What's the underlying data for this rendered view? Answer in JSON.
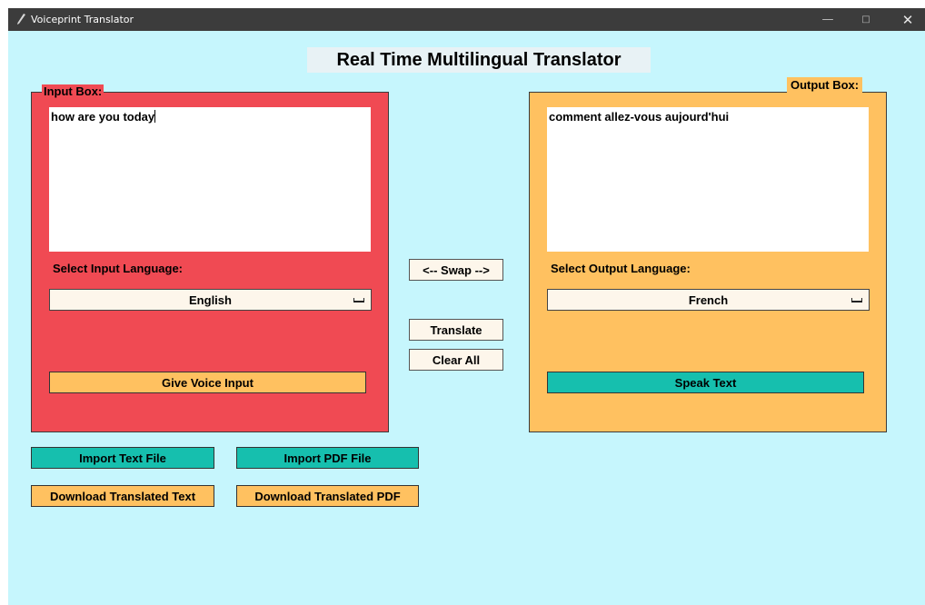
{
  "window": {
    "title": "Voiceprint Translator",
    "controls": {
      "minimize": "—",
      "maximize": "□",
      "close": "✕"
    }
  },
  "app": {
    "heading": "Real Time Multilingual Translator"
  },
  "input_panel": {
    "legend": "Input Box:",
    "text": "how are you today",
    "language_label": "Select Input Language:",
    "language_selected": "English",
    "voice_button": "Give Voice Input"
  },
  "output_panel": {
    "legend": "Output Box:",
    "text": "comment allez-vous aujourd'hui",
    "language_label": "Select Output Language:",
    "language_selected": "French",
    "speak_button": "Speak Text"
  },
  "center_buttons": {
    "swap": "<-- Swap -->",
    "translate": "Translate",
    "clear": "Clear All"
  },
  "file_buttons": {
    "import_text": "Import Text File",
    "import_pdf": "Import PDF File",
    "download_text": "Download Translated Text",
    "download_pdf": "Download Translated PDF"
  },
  "colors": {
    "background": "#c6f6fd",
    "input_panel": "#f04a53",
    "output_panel": "#ffc160",
    "teal_button": "#16bfae",
    "orange_button": "#ffc160",
    "titlebar": "#3c3c3c"
  }
}
